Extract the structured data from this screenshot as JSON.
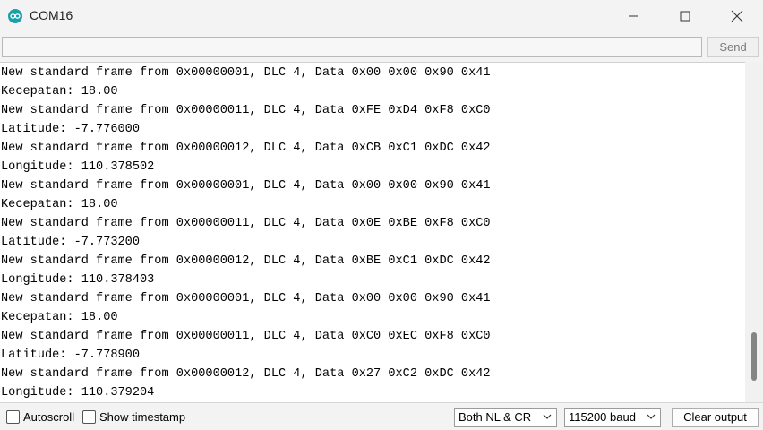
{
  "window": {
    "title": "COM16"
  },
  "send_row": {
    "input_value": "",
    "send_label": "Send"
  },
  "output": {
    "lines": [
      "New standard frame from 0x00000001, DLC 4, Data 0x00 0x00 0x90 0x41",
      "Kecepatan: 18.00",
      "New standard frame from 0x00000011, DLC 4, Data 0xFE 0xD4 0xF8 0xC0",
      "Latitude: -7.776000",
      "New standard frame from 0x00000012, DLC 4, Data 0xCB 0xC1 0xDC 0x42",
      "Longitude: 110.378502",
      "New standard frame from 0x00000001, DLC 4, Data 0x00 0x00 0x90 0x41",
      "Kecepatan: 18.00",
      "New standard frame from 0x00000011, DLC 4, Data 0x0E 0xBE 0xF8 0xC0",
      "Latitude: -7.773200",
      "New standard frame from 0x00000012, DLC 4, Data 0xBE 0xC1 0xDC 0x42",
      "Longitude: 110.378403",
      "New standard frame from 0x00000001, DLC 4, Data 0x00 0x00 0x90 0x41",
      "Kecepatan: 18.00",
      "New standard frame from 0x00000011, DLC 4, Data 0xC0 0xEC 0xF8 0xC0",
      "Latitude: -7.778900",
      "New standard frame from 0x00000012, DLC 4, Data 0x27 0xC2 0xDC 0x42",
      "Longitude: 110.379204"
    ]
  },
  "bottom": {
    "autoscroll_label": "Autoscroll",
    "autoscroll_checked": false,
    "timestamp_label": "Show timestamp",
    "timestamp_checked": false,
    "line_ending": "Both NL & CR",
    "baud": "115200 baud",
    "clear_label": "Clear output"
  },
  "colors": {
    "app_icon": "#1aa0a8",
    "scroll_thumb": "#858585"
  }
}
